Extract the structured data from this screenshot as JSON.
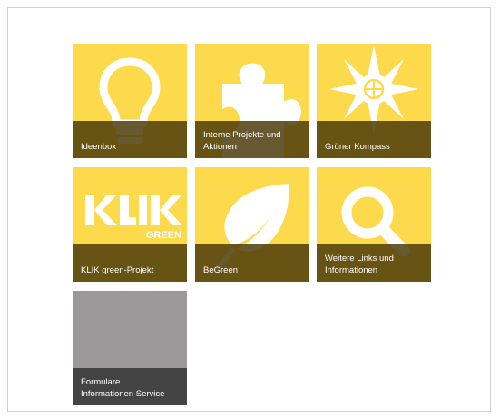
{
  "tiles": [
    {
      "label": "Ideenbox",
      "icon": "lightbulb-icon"
    },
    {
      "label": "Interne Projekte und\nAktionen",
      "icon": "puzzle-piece-icon"
    },
    {
      "label": "Grüner Kompass",
      "icon": "compass-icon"
    },
    {
      "label": "KLIK green-Projekt",
      "icon": "klik-green-logo",
      "logo_text": "KLIK GREEN"
    },
    {
      "label": "BeGreen",
      "icon": "leaf-icon"
    },
    {
      "label": "Weitere Links und\nInformationen",
      "icon": "magnifier-icon"
    },
    {
      "label": "Formulare\nInformationen Service",
      "icon": ""
    }
  ],
  "colors": {
    "tile_yellow": "#fdd94c",
    "caption_brown": "#4c3c0c",
    "tile_gray": "#9a9898",
    "caption_dark_gray": "#444444"
  }
}
